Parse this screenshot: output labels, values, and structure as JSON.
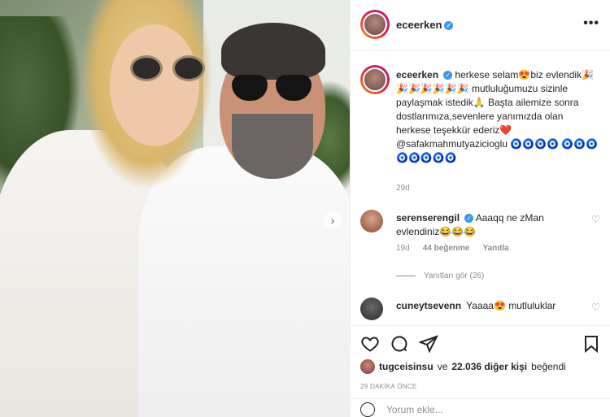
{
  "post": {
    "username": "eceerken",
    "verified_mark": "✓",
    "more_label": "•••",
    "caption": "herkese selam😍biz evlendik🎉🎉🎉🎉🎉🎉🎉 mutluluğumuzu sizinle paylaşmak istedik🙏 Başta ailemize sonra dostlarımıza,sevenlere yanımızda olan herkese teşekkür ederiz❤️ @safakmahmutyazicioglu 🧿🧿🧿🧿 🧿🧿🧿🧿🧿🧿🧿🧿",
    "caption_time": "29d"
  },
  "comments": [
    {
      "username": "serenserengil",
      "text": "Aaaqq ne zMan evlendiniz😂😂😂",
      "time": "19d",
      "likes": "44 beğenme",
      "reply": "Yanıtla"
    },
    {
      "username": "cuneytsevenn",
      "text": "Yaaaa😍 mutluluklar"
    }
  ],
  "replies_label": "Yanıtları gör (26)",
  "likes": {
    "liker": "tugceisinsu",
    "connector": "ve",
    "others": "22.036 diğer kişi",
    "suffix": "beğendi"
  },
  "post_time": "29 DAKİKA ÖNCE",
  "add_comment_placeholder": "Yorum ekle...",
  "icons": {
    "carousel_next": "›",
    "comment_heart": "♡"
  }
}
